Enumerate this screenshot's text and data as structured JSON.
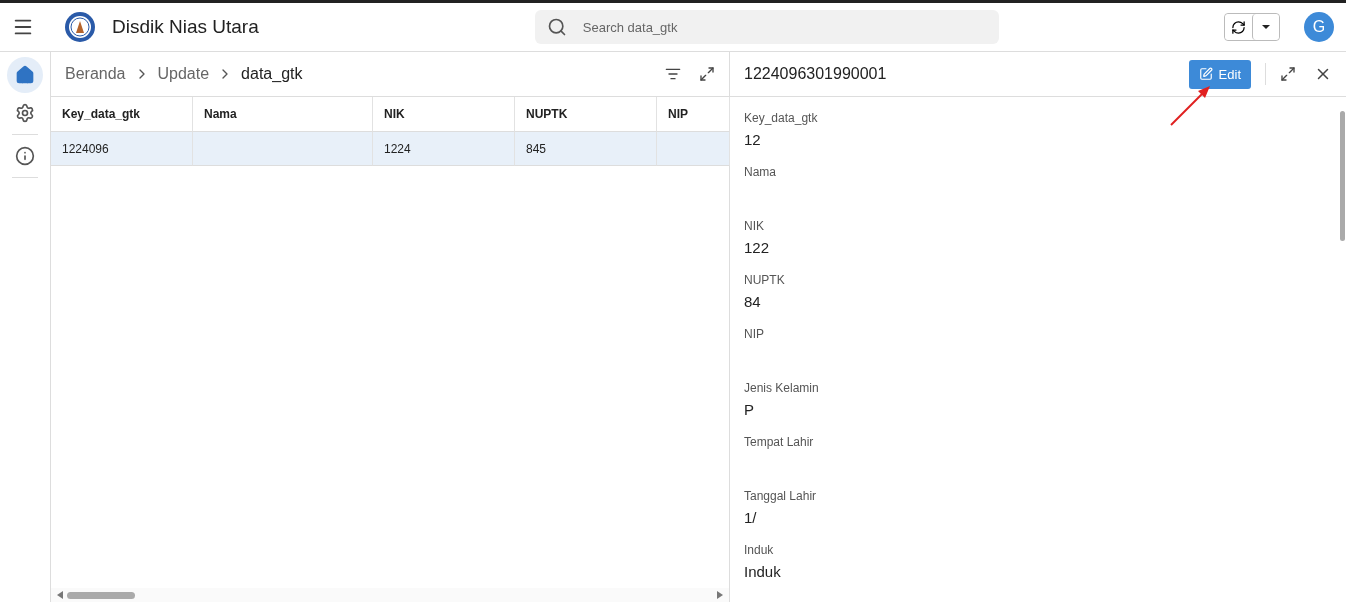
{
  "app_bar": {
    "title": "Disdik Nias Utara",
    "search": {
      "placeholder": "Search data_gtk"
    },
    "avatar": "G"
  },
  "rail": [
    {
      "selected": true
    },
    {
      "selected": false
    },
    {
      "selected": false
    }
  ],
  "breadcrumb": [
    "Beranda",
    "Update",
    "data_gtk"
  ],
  "table": {
    "columns": [
      "Key_data_gtk",
      "Nama",
      "NIK",
      "NUPTK",
      "NIP"
    ],
    "rows": [
      {
        "selected": true,
        "cells": [
          "1224096",
          null,
          "1224",
          "845",
          null
        ]
      }
    ]
  },
  "detail": {
    "title": "1224096301990001",
    "edit_button": "Edit",
    "fields": [
      {
        "label": "Key_data_gtk",
        "value": "12"
      },
      {
        "label": "Nama"
      },
      {
        "label": "NIK",
        "value": "122"
      },
      {
        "label": "NUPTK",
        "value": "84"
      },
      {
        "label": "NIP"
      },
      {
        "label": "Jenis Kelamin",
        "value": "P"
      },
      {
        "label": "Tempat Lahir"
      },
      {
        "label": "Tanggal Lahir",
        "value": "1/"
      },
      {
        "label": "Induk",
        "value": "Induk"
      }
    ]
  }
}
